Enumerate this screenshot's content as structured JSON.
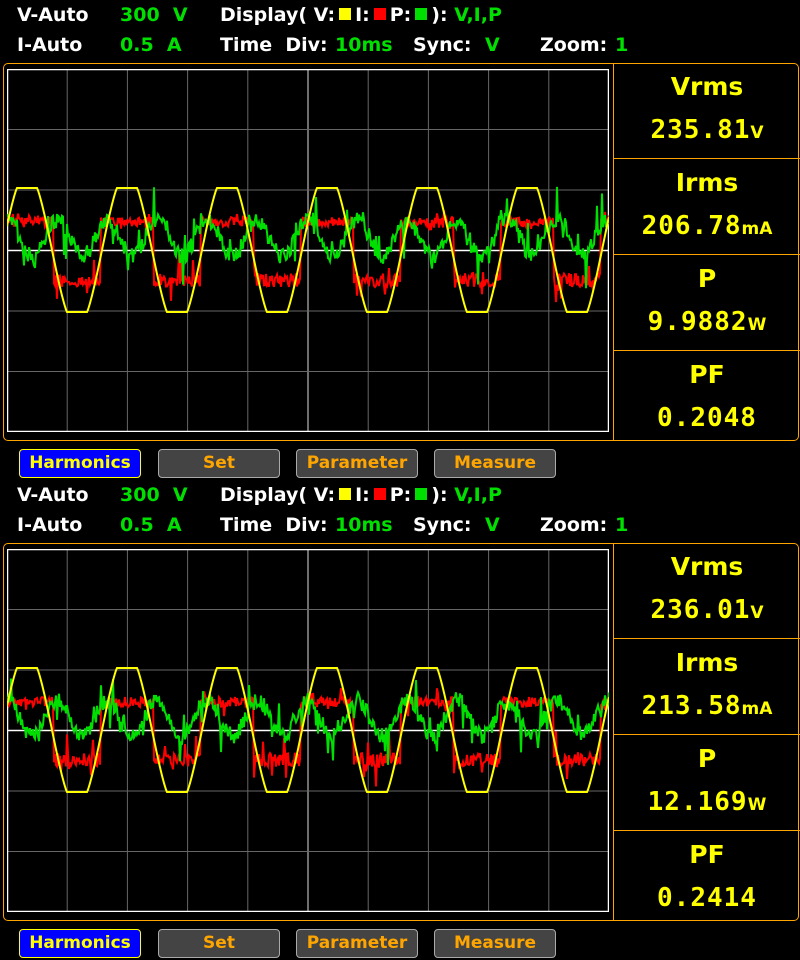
{
  "colors": {
    "voltage": "#ffff00",
    "current": "#ff0000",
    "power": "#00e000",
    "accent": "#ffa500"
  },
  "panels": [
    {
      "header": {
        "v_range_label": "V-Auto",
        "v_range_value": "300  V",
        "display_label": "Display( V:",
        "i_key": "I:",
        "p_key": "P:",
        "display_close": "):",
        "display_value": "V,I,P",
        "i_range_label": "I-Auto",
        "i_range_value": "0.5  A",
        "time_div_label": "Time  Div:",
        "time_div_value": "10ms",
        "sync_label": "Sync:",
        "sync_value": "V",
        "zoom_label": "Zoom:",
        "zoom_value": "1"
      },
      "readings": [
        {
          "label": "Vrms",
          "value": "235.81",
          "unit": "V"
        },
        {
          "label": "Irms",
          "value": "206.78",
          "unit": "mA"
        },
        {
          "label": "P",
          "value": "9.9882",
          "unit": "W"
        },
        {
          "label": "PF",
          "value": "0.2048",
          "unit": ""
        }
      ],
      "buttons": [
        "Harmonics",
        "Set",
        "Parameter",
        "Measure"
      ]
    },
    {
      "header": {
        "v_range_label": "V-Auto",
        "v_range_value": "300  V",
        "display_label": "Display( V:",
        "i_key": "I:",
        "p_key": "P:",
        "display_close": "):",
        "display_value": "V,I,P",
        "i_range_label": "I-Auto",
        "i_range_value": "0.5  A",
        "time_div_label": "Time  Div:",
        "time_div_value": "10ms",
        "sync_label": "Sync:",
        "sync_value": "V",
        "zoom_label": "Zoom:",
        "zoom_value": "1"
      },
      "readings": [
        {
          "label": "Vrms",
          "value": "236.01",
          "unit": "V"
        },
        {
          "label": "Irms",
          "value": "213.58",
          "unit": "mA"
        },
        {
          "label": "P",
          "value": "12.169",
          "unit": "W"
        },
        {
          "label": "PF",
          "value": "0.2414",
          "unit": ""
        }
      ],
      "buttons": [
        "Harmonics",
        "Set",
        "Parameter",
        "Measure"
      ]
    }
  ]
}
